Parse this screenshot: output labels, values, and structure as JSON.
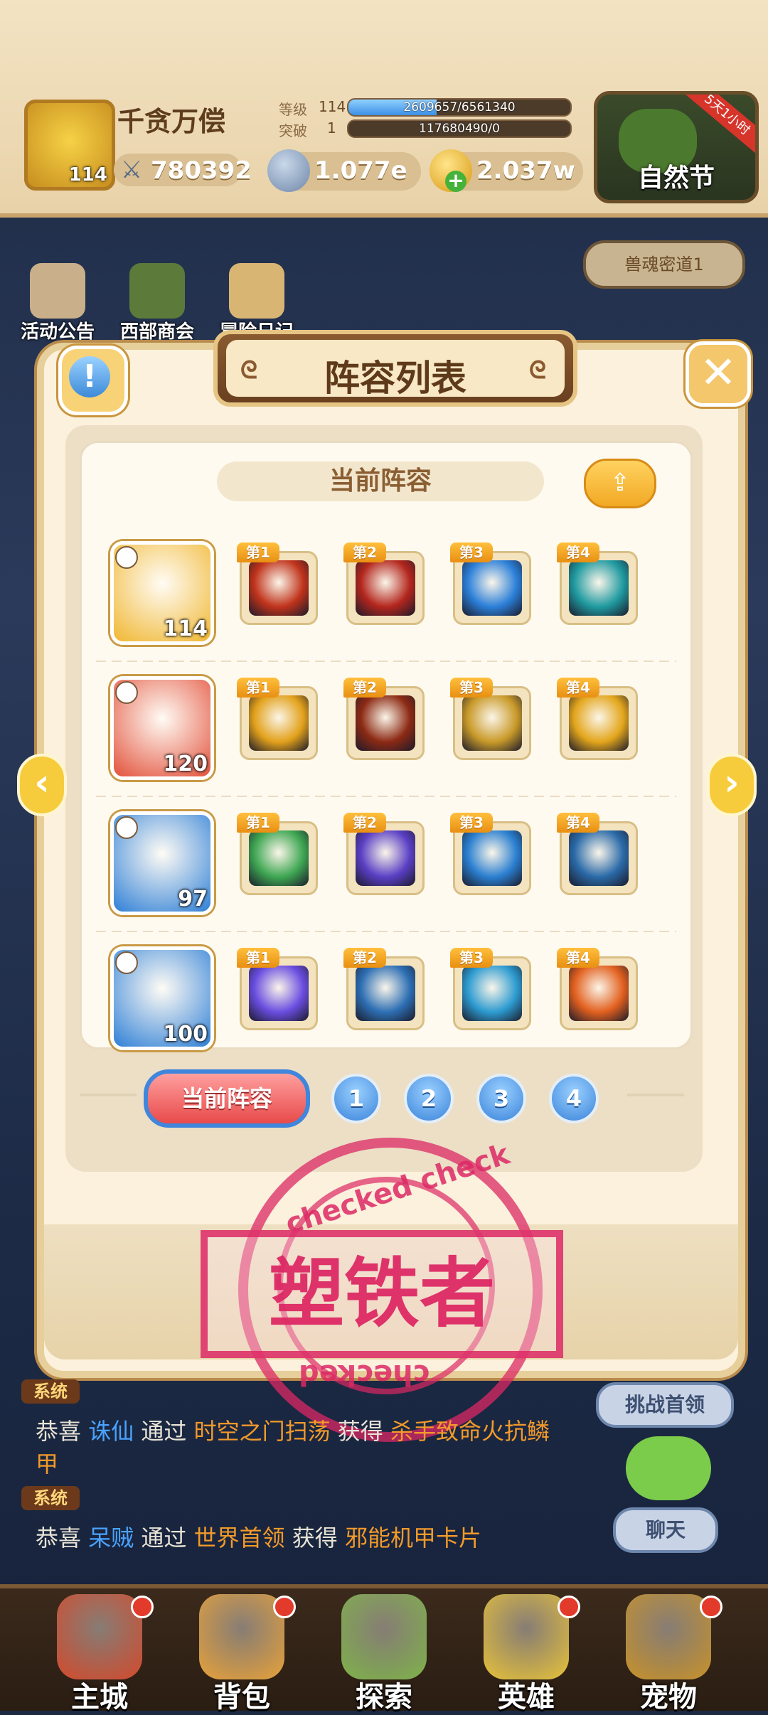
{
  "player": {
    "name": "千贪万偿",
    "level": "114",
    "power": "780392",
    "stats": [
      {
        "label": "等级",
        "value": "114",
        "progress_text": "2609657/6561340",
        "progress": 0.398
      },
      {
        "label": "突破",
        "value": "1",
        "progress_text": "117680490/0",
        "progress": 0.0
      }
    ],
    "currencies": [
      {
        "name": "silver-coin",
        "value": "1.077e"
      },
      {
        "name": "gold-coin",
        "value": "2.037w"
      }
    ]
  },
  "event": {
    "label": "自然节",
    "ribbon": "5天1小时"
  },
  "world": {
    "buttons": [
      {
        "label": "活动公告"
      },
      {
        "label": "西部商会"
      },
      {
        "label": "冒险日记"
      }
    ],
    "dungeon_label": "兽魂密道1"
  },
  "modal": {
    "title": "阵容列表",
    "subtitle": "当前阵容",
    "close_glyph": "✕",
    "info_glyph": "!",
    "rows": [
      {
        "hero_level": "114",
        "hero_color": "#f0b731",
        "skills": [
          {
            "tag": "第1",
            "color": "#c0331b"
          },
          {
            "tag": "第2",
            "color": "#b3261d"
          },
          {
            "tag": "第3",
            "color": "#2b7fd8"
          },
          {
            "tag": "第4",
            "color": "#1f9aa0"
          }
        ]
      },
      {
        "hero_level": "120",
        "hero_color": "#e2513b",
        "skills": [
          {
            "tag": "第1",
            "color": "#e2a11b"
          },
          {
            "tag": "第2",
            "color": "#8c2a14"
          },
          {
            "tag": "第3",
            "color": "#c99a2a"
          },
          {
            "tag": "第4",
            "color": "#e3a61c"
          }
        ]
      },
      {
        "hero_level": "97",
        "hero_color": "#2e7fd6",
        "skills": [
          {
            "tag": "第1",
            "color": "#3ea652"
          },
          {
            "tag": "第2",
            "color": "#5a3fc4"
          },
          {
            "tag": "第3",
            "color": "#2a7fd0"
          },
          {
            "tag": "第4",
            "color": "#2a6aa8"
          }
        ]
      },
      {
        "hero_level": "100",
        "hero_color": "#2e7fd6",
        "skills": [
          {
            "tag": "第1",
            "color": "#6a4de0"
          },
          {
            "tag": "第2",
            "color": "#2d6fb4"
          },
          {
            "tag": "第3",
            "color": "#2d9bd0"
          },
          {
            "tag": "第4",
            "color": "#e2601f"
          }
        ]
      }
    ],
    "tabs": {
      "current": "当前阵容",
      "numbers": [
        "1",
        "2",
        "3",
        "4"
      ]
    }
  },
  "stamp": {
    "main": "塑铁者",
    "ring_top": "checked   check",
    "ring_bottom": "checked"
  },
  "chat": {
    "messages": [
      {
        "tag": "系统",
        "parts": [
          "恭喜 ",
          "诛仙",
          " 通过 ",
          "时空之门扫荡",
          " 获得 ",
          "杀手致命火抗鳞",
          "甲"
        ]
      },
      {
        "tag": "系统",
        "parts": [
          "恭喜 ",
          "呆贼",
          " 通过 ",
          "世界首领",
          " 获得 ",
          "邪能机甲卡片"
        ]
      }
    ],
    "challenge_label": "挑战首领",
    "chat_label": "聊天"
  },
  "nav": {
    "items": [
      {
        "label": "主城",
        "color": "#d44a2c"
      },
      {
        "label": "背包",
        "color": "#e8a23a"
      },
      {
        "label": "探索",
        "color": "#7fb34a"
      },
      {
        "label": "英雄",
        "color": "#e8c23a"
      },
      {
        "label": "宠物",
        "color": "#c8922a"
      }
    ]
  },
  "colors": {
    "accent": "#f7cc3c",
    "tab_blue": "#3b84da",
    "tab_red": "#e84a4a",
    "stamp": "#dc2864"
  }
}
